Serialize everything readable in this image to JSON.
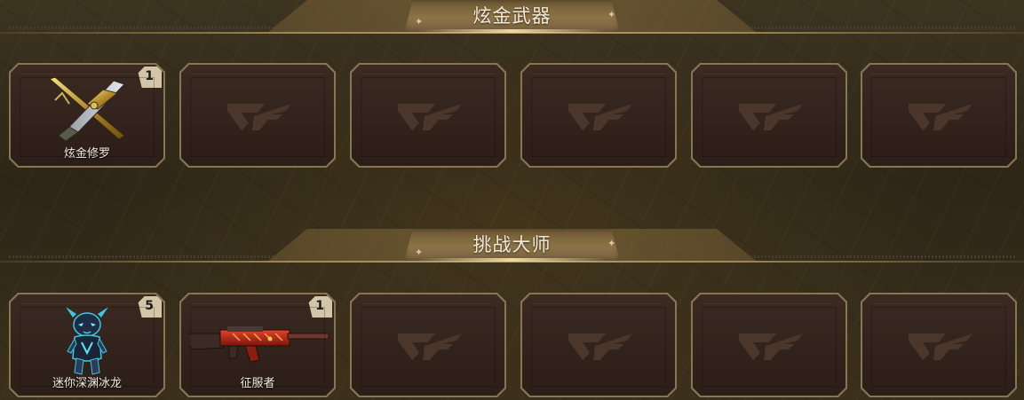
{
  "sections": [
    {
      "title": "炫金武器",
      "slots": [
        {
          "filled": true,
          "name": "炫金修罗",
          "count": "1",
          "icon": "crossed-gold-weapons-icon"
        },
        {
          "filled": false,
          "icon": "cf-logo-icon"
        },
        {
          "filled": false,
          "icon": "cf-logo-icon"
        },
        {
          "filled": false,
          "icon": "cf-logo-icon"
        },
        {
          "filled": false,
          "icon": "cf-logo-icon"
        },
        {
          "filled": false,
          "icon": "cf-logo-icon"
        }
      ]
    },
    {
      "title": "挑战大师",
      "slots": [
        {
          "filled": true,
          "name": "迷你深渊冰龙",
          "count": "5",
          "icon": "mini-ice-dragon-figure-icon"
        },
        {
          "filled": true,
          "name": "征服者",
          "count": "1",
          "icon": "red-rifle-icon"
        },
        {
          "filled": false,
          "icon": "cf-logo-icon"
        },
        {
          "filled": false,
          "icon": "cf-logo-icon"
        },
        {
          "filled": false,
          "icon": "cf-logo-icon"
        },
        {
          "filled": false,
          "icon": "cf-logo-icon"
        }
      ]
    }
  ],
  "colors": {
    "background": "#2d2617",
    "slot_border": "#8a7552",
    "slot_fill": "#33241d",
    "badge": "#d3c6a8",
    "banner_plate": "#8c7347",
    "title_text": "#f3ead6"
  }
}
